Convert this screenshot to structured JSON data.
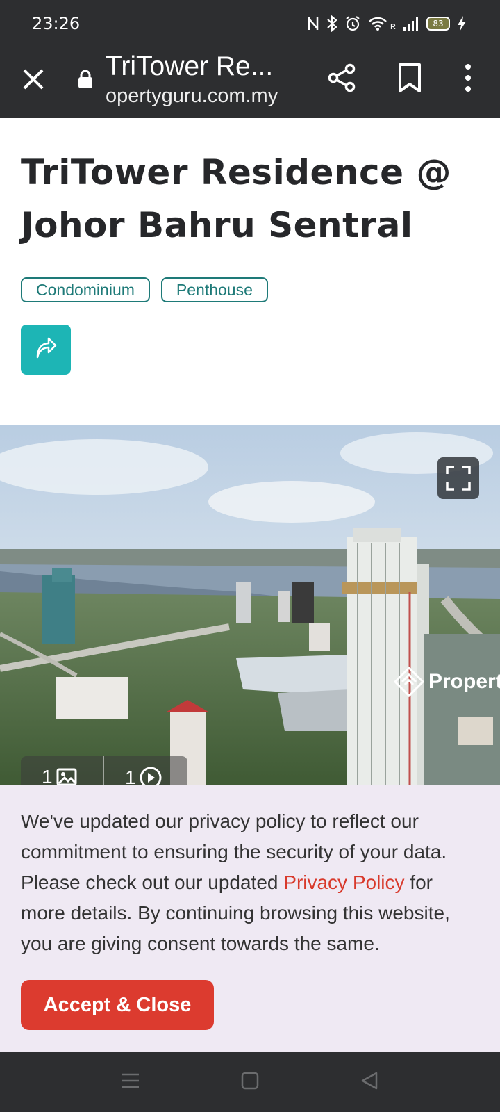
{
  "status_bar": {
    "time": "23:26",
    "battery": "83",
    "network": "R",
    "icons": [
      "nfc-icon",
      "bluetooth-icon",
      "alarm-icon",
      "wifi-icon",
      "signal-icon",
      "battery-icon",
      "charging-icon"
    ]
  },
  "toolbar": {
    "title": "TriTower Re...",
    "url": "opertyguru.com.my",
    "icons": [
      "close-icon",
      "lock-icon",
      "share-icon",
      "bookmark-icon",
      "more-vert-icon"
    ]
  },
  "listing": {
    "title": "TriTower Residence @ Johor Bahru Sentral",
    "tags": [
      "Condominium",
      "Penthouse"
    ]
  },
  "hero": {
    "photo_count": "1",
    "video_count": "1",
    "watermark": "Propert"
  },
  "privacy": {
    "text_before": "We've updated our privacy policy to reflect our commitment to ensuring the security of your data. Please check out our updated ",
    "link": "Privacy Policy",
    "text_after": " for more details. By continuing browsing this website, you are giving consent towards the same.",
    "button": "Accept & Close"
  },
  "colors": {
    "bar_bg": "#2d2e30",
    "teal": "#1db5b5",
    "tag_border": "#1e7a78",
    "accept_red": "#dc3b2f",
    "banner_bg": "#efe9f3"
  }
}
